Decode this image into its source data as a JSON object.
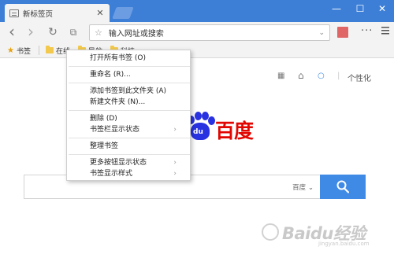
{
  "tab": {
    "title": "新标签页",
    "close": "✕"
  },
  "window_controls": {
    "minimize": "—",
    "maximize": "☐",
    "close": "✕"
  },
  "toolbar": {
    "back": "‹",
    "forward": "›",
    "reload": "↻",
    "reader": "⧉",
    "menu_dots": "···"
  },
  "address_bar": {
    "star": "☆",
    "text": "输入网址或搜索",
    "dropdown": "⌄"
  },
  "bookmarks_bar": {
    "star": "★",
    "items": [
      {
        "label": "书签"
      },
      {
        "label": "在线"
      },
      {
        "label": "导航"
      },
      {
        "label": "科技"
      }
    ]
  },
  "page_tools": {
    "grid": "▦",
    "home": "⌂",
    "search": "○",
    "separator": "|",
    "personalize": "个性化"
  },
  "logo": {
    "du": "du",
    "text": "百度"
  },
  "search": {
    "engine": "百度 ⌄"
  },
  "context_menu": {
    "groups": [
      [
        {
          "label": "打开所有书签 (O)"
        }
      ],
      [
        {
          "label": "重命名 (R)..."
        }
      ],
      [
        {
          "label": "添加书签到此文件夹 (A)"
        },
        {
          "label": "新建文件夹 (N)..."
        }
      ],
      [
        {
          "label": "删除 (D)"
        },
        {
          "label": "书签栏显示状态",
          "submenu": "›"
        }
      ],
      [
        {
          "label": "整理书签"
        }
      ],
      [
        {
          "label": "更多按钮显示状态",
          "submenu": "›"
        },
        {
          "label": "书签显示样式",
          "submenu": "›"
        }
      ]
    ]
  },
  "watermark": {
    "brand": "Baidu经验",
    "sub": "jingyan.baidu.com"
  },
  "colors": {
    "titlebar": "#3d7fd7",
    "search_button": "#3f8ae5",
    "logo_blue": "#2932e1",
    "logo_red": "#e10601"
  }
}
